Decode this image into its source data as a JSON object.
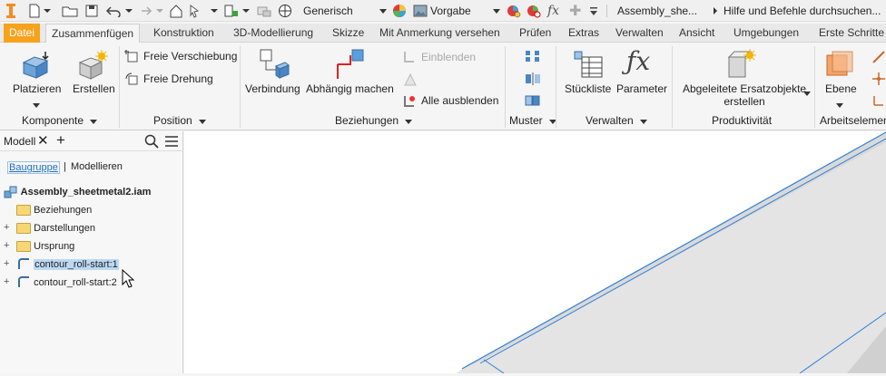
{
  "qat": {
    "material": "Generisch",
    "appearance": "Vorgabe",
    "doc_title": "Assembly_she...",
    "search_placeholder": "Hilfe und Befehle durchsuchen...",
    "fx": "fx"
  },
  "tabs": [
    {
      "label": "Datei"
    },
    {
      "label": "Zusammenfügen"
    },
    {
      "label": "Konstruktion"
    },
    {
      "label": "3D-Modellierung"
    },
    {
      "label": "Skizze"
    },
    {
      "label": "Mit Anmerkung versehen"
    },
    {
      "label": "Prüfen"
    },
    {
      "label": "Extras"
    },
    {
      "label": "Verwalten"
    },
    {
      "label": "Ansicht"
    },
    {
      "label": "Umgebungen"
    },
    {
      "label": "Erste Schritte"
    }
  ],
  "ribbon": {
    "komponente": {
      "title": "Komponente",
      "platzieren": "Platzieren",
      "erstellen": "Erstellen"
    },
    "position": {
      "title": "Position",
      "freie_verschiebung": "Freie Verschiebung",
      "freie_drehung": "Freie Drehung"
    },
    "beziehungen": {
      "title": "Beziehungen",
      "verbindung": "Verbindung",
      "abhaengig": "Abhängig machen",
      "einblenden": "Einblenden",
      "alle_ausblenden": "Alle ausblenden"
    },
    "muster": {
      "title": "Muster"
    },
    "verwalten": {
      "title": "Verwalten",
      "stueckliste": "Stückliste",
      "parameter": "Parameter"
    },
    "produktivitaet": {
      "title": "Produktivität",
      "abgeleitete_1": "Abgeleitete Ersatzobjekte",
      "abgeleitete_2": "erstellen"
    },
    "arbeitselemente": {
      "title": "Arbeitselemen",
      "ebene": "Ebene"
    }
  },
  "browser": {
    "tab_label": "Modell",
    "view_baugruppe": "Baugruppe",
    "view_modellieren": "Modellieren",
    "root": "Assembly_sheetmetal2.iam",
    "items": [
      {
        "label": "Beziehungen"
      },
      {
        "label": "Darstellungen"
      },
      {
        "label": "Ursprung"
      },
      {
        "label": "contour_roll-start:1"
      },
      {
        "label": "contour_roll-start:2"
      }
    ]
  },
  "colors": {
    "file_tab": "#f7a21c",
    "selection": "#bcd9f3",
    "edge": "#2f7fd6"
  }
}
